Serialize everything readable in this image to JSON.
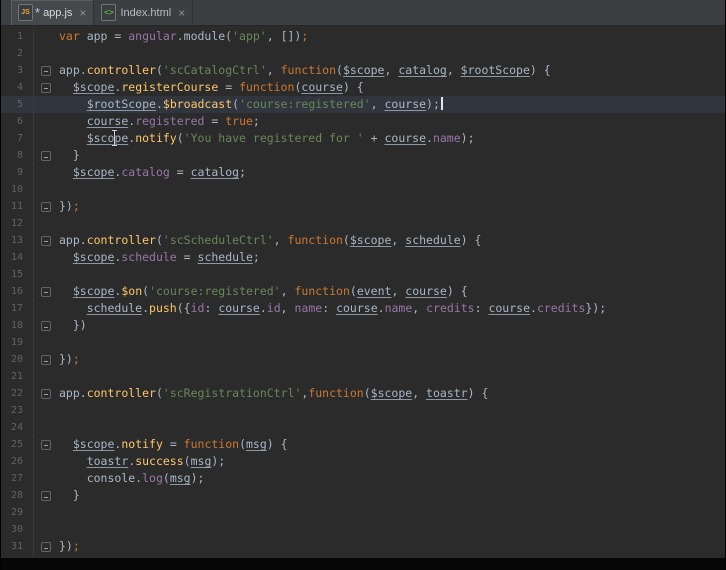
{
  "tabs": [
    {
      "label": "app.js",
      "icon": "js-file-icon",
      "icon_text": "JS",
      "modified_mark": "*",
      "close_mark": "×",
      "active": true
    },
    {
      "label": "Index.html",
      "icon": "html-file-icon",
      "icon_text": "<>",
      "modified_mark": "",
      "close_mark": "×",
      "active": false
    }
  ],
  "colors": {
    "editor_background": "#2b2b2b",
    "tab_bar": "#3c3f41",
    "caret_line": "#31363e",
    "keyword": "#cc7832",
    "string": "#6a8759",
    "method": "#ffc66d",
    "property": "#9876aa",
    "default_text": "#a9b7c6",
    "line_number": "#606366"
  },
  "editor": {
    "language": "javascript",
    "active_line": 5,
    "caret": {
      "line": 5
    },
    "total_lines": 31,
    "lines": [
      {
        "n": 1,
        "fold": null,
        "tokens": [
          [
            "kw",
            "var"
          ],
          [
            "d",
            " app = "
          ],
          [
            "glob",
            "angular"
          ],
          [
            "d",
            ".module("
          ],
          [
            "str",
            "'app'"
          ],
          [
            "d",
            ", [])"
          ],
          [
            "semi",
            ";"
          ]
        ]
      },
      {
        "n": 2,
        "fold": null,
        "tokens": []
      },
      {
        "n": 3,
        "fold": "start",
        "tokens": [
          [
            "d",
            "app."
          ],
          [
            "fn",
            "controller"
          ],
          [
            "d",
            "("
          ],
          [
            "str",
            "'scCatalogCtrl'"
          ],
          [
            "d",
            ", "
          ],
          [
            "kw",
            "function"
          ],
          [
            "d",
            "("
          ],
          [
            "p",
            "$scope"
          ],
          [
            "d",
            ", "
          ],
          [
            "p",
            "catalog"
          ],
          [
            "d",
            ", "
          ],
          [
            "p",
            "$rootScope"
          ],
          [
            "d",
            ") {"
          ]
        ]
      },
      {
        "n": 4,
        "fold": "start",
        "tokens": [
          [
            "d",
            "  "
          ],
          [
            "p",
            "$scope"
          ],
          [
            "d",
            "."
          ],
          [
            "fn",
            "registerCourse"
          ],
          [
            "d",
            " = "
          ],
          [
            "kw",
            "function"
          ],
          [
            "d",
            "("
          ],
          [
            "p",
            "course"
          ],
          [
            "d",
            ") {"
          ]
        ]
      },
      {
        "n": 5,
        "fold": null,
        "tokens": [
          [
            "d",
            "    "
          ],
          [
            "p",
            "$rootScope"
          ],
          [
            "d",
            "."
          ],
          [
            "fn",
            "$broadcast"
          ],
          [
            "d",
            "("
          ],
          [
            "str",
            "'course:registered'"
          ],
          [
            "d",
            ", "
          ],
          [
            "p",
            "course"
          ],
          [
            "d",
            ");"
          ]
        ]
      },
      {
        "n": 6,
        "fold": null,
        "tokens": [
          [
            "d",
            "    "
          ],
          [
            "p",
            "course"
          ],
          [
            "d",
            "."
          ],
          [
            "prop",
            "registered"
          ],
          [
            "d",
            " = "
          ],
          [
            "kw",
            "true"
          ],
          [
            "d",
            ";"
          ]
        ]
      },
      {
        "n": 7,
        "fold": null,
        "tokens": [
          [
            "d",
            "    "
          ],
          [
            "p",
            "$scope"
          ],
          [
            "d",
            "."
          ],
          [
            "fn",
            "notify"
          ],
          [
            "d",
            "("
          ],
          [
            "str",
            "'You have registered for '"
          ],
          [
            "d",
            " + "
          ],
          [
            "p",
            "course"
          ],
          [
            "d",
            "."
          ],
          [
            "prop",
            "name"
          ],
          [
            "d",
            ");"
          ]
        ]
      },
      {
        "n": 8,
        "fold": "end",
        "tokens": [
          [
            "d",
            "  }"
          ]
        ]
      },
      {
        "n": 9,
        "fold": null,
        "tokens": [
          [
            "d",
            "  "
          ],
          [
            "p",
            "$scope"
          ],
          [
            "d",
            "."
          ],
          [
            "prop",
            "catalog"
          ],
          [
            "d",
            " = "
          ],
          [
            "p",
            "catalog"
          ],
          [
            "d",
            ";"
          ]
        ]
      },
      {
        "n": 10,
        "fold": null,
        "tokens": []
      },
      {
        "n": 11,
        "fold": "end",
        "tokens": [
          [
            "d",
            "})"
          ],
          [
            "semi",
            ";"
          ]
        ]
      },
      {
        "n": 12,
        "fold": null,
        "tokens": []
      },
      {
        "n": 13,
        "fold": "start",
        "tokens": [
          [
            "d",
            "app."
          ],
          [
            "fn",
            "controller"
          ],
          [
            "d",
            "("
          ],
          [
            "str",
            "'scScheduleCtrl'"
          ],
          [
            "d",
            ", "
          ],
          [
            "kw",
            "function"
          ],
          [
            "d",
            "("
          ],
          [
            "p",
            "$scope"
          ],
          [
            "d",
            ", "
          ],
          [
            "p",
            "schedule"
          ],
          [
            "d",
            ") {"
          ]
        ]
      },
      {
        "n": 14,
        "fold": null,
        "tokens": [
          [
            "d",
            "  "
          ],
          [
            "p",
            "$scope"
          ],
          [
            "d",
            "."
          ],
          [
            "prop",
            "schedule"
          ],
          [
            "d",
            " = "
          ],
          [
            "p",
            "schedule"
          ],
          [
            "d",
            ";"
          ]
        ]
      },
      {
        "n": 15,
        "fold": null,
        "tokens": []
      },
      {
        "n": 16,
        "fold": "start",
        "tokens": [
          [
            "d",
            "  "
          ],
          [
            "p",
            "$scope"
          ],
          [
            "d",
            "."
          ],
          [
            "fn",
            "$on"
          ],
          [
            "d",
            "("
          ],
          [
            "str",
            "'course:registered'"
          ],
          [
            "d",
            ", "
          ],
          [
            "kw",
            "function"
          ],
          [
            "d",
            "("
          ],
          [
            "p",
            "event"
          ],
          [
            "d",
            ", "
          ],
          [
            "p",
            "course"
          ],
          [
            "d",
            ") {"
          ]
        ]
      },
      {
        "n": 17,
        "fold": null,
        "tokens": [
          [
            "d",
            "    "
          ],
          [
            "p",
            "schedule"
          ],
          [
            "d",
            "."
          ],
          [
            "fn",
            "push"
          ],
          [
            "d",
            "({"
          ],
          [
            "prop",
            "id"
          ],
          [
            "d",
            ": "
          ],
          [
            "p",
            "course"
          ],
          [
            "d",
            "."
          ],
          [
            "prop",
            "id"
          ],
          [
            "d",
            ", "
          ],
          [
            "prop",
            "name"
          ],
          [
            "d",
            ": "
          ],
          [
            "p",
            "course"
          ],
          [
            "d",
            "."
          ],
          [
            "prop",
            "name"
          ],
          [
            "d",
            ", "
          ],
          [
            "prop",
            "credits"
          ],
          [
            "d",
            ": "
          ],
          [
            "p",
            "course"
          ],
          [
            "d",
            "."
          ],
          [
            "prop",
            "credits"
          ],
          [
            "d",
            "});"
          ]
        ]
      },
      {
        "n": 18,
        "fold": "end",
        "tokens": [
          [
            "d",
            "  })"
          ]
        ]
      },
      {
        "n": 19,
        "fold": null,
        "tokens": []
      },
      {
        "n": 20,
        "fold": "end",
        "tokens": [
          [
            "d",
            "})"
          ],
          [
            "semi",
            ";"
          ]
        ]
      },
      {
        "n": 21,
        "fold": null,
        "tokens": []
      },
      {
        "n": 22,
        "fold": "start",
        "tokens": [
          [
            "d",
            "app."
          ],
          [
            "fn",
            "controller"
          ],
          [
            "d",
            "("
          ],
          [
            "str",
            "'scRegistrationCtrl'"
          ],
          [
            "d",
            ","
          ],
          [
            "kw",
            "function"
          ],
          [
            "d",
            "("
          ],
          [
            "p",
            "$scope"
          ],
          [
            "d",
            ", "
          ],
          [
            "p",
            "toastr"
          ],
          [
            "d",
            ") {"
          ]
        ]
      },
      {
        "n": 23,
        "fold": null,
        "tokens": []
      },
      {
        "n": 24,
        "fold": null,
        "tokens": []
      },
      {
        "n": 25,
        "fold": "start",
        "tokens": [
          [
            "d",
            "  "
          ],
          [
            "p",
            "$scope"
          ],
          [
            "d",
            "."
          ],
          [
            "fn",
            "notify"
          ],
          [
            "d",
            " = "
          ],
          [
            "kw",
            "function"
          ],
          [
            "d",
            "("
          ],
          [
            "p",
            "msg"
          ],
          [
            "d",
            ") {"
          ]
        ]
      },
      {
        "n": 26,
        "fold": null,
        "tokens": [
          [
            "d",
            "    "
          ],
          [
            "p",
            "toastr"
          ],
          [
            "d",
            "."
          ],
          [
            "fn",
            "success"
          ],
          [
            "d",
            "("
          ],
          [
            "p",
            "msg"
          ],
          [
            "d",
            ");"
          ]
        ]
      },
      {
        "n": 27,
        "fold": null,
        "tokens": [
          [
            "d",
            "    console."
          ],
          [
            "prop",
            "log"
          ],
          [
            "d",
            "("
          ],
          [
            "p",
            "msg"
          ],
          [
            "d",
            ");"
          ]
        ]
      },
      {
        "n": 28,
        "fold": "end",
        "tokens": [
          [
            "d",
            "  }"
          ]
        ]
      },
      {
        "n": 29,
        "fold": null,
        "tokens": []
      },
      {
        "n": 30,
        "fold": null,
        "tokens": []
      },
      {
        "n": 31,
        "fold": "end",
        "tokens": [
          [
            "d",
            "})"
          ],
          [
            "semi",
            ";"
          ]
        ]
      }
    ]
  }
}
